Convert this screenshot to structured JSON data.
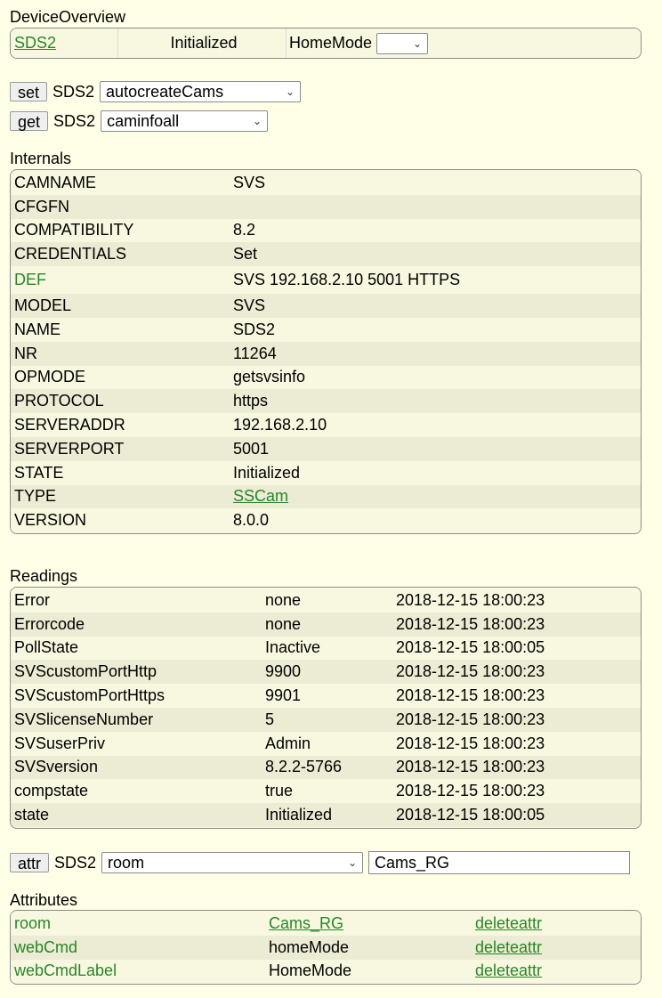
{
  "overview": {
    "title": "DeviceOverview",
    "device_link": "SDS2",
    "state": "Initialized",
    "homemode_label": "HomeMode",
    "homemode_value": ""
  },
  "set_row": {
    "button": "set",
    "device": "SDS2",
    "selected": "autocreateCams"
  },
  "get_row": {
    "button": "get",
    "device": "SDS2",
    "selected": "caminfoall"
  },
  "internals": {
    "title": "Internals",
    "rows": [
      {
        "key": "CAMNAME",
        "value": "SVS"
      },
      {
        "key": "CFGFN",
        "value": ""
      },
      {
        "key": "COMPATIBILITY",
        "value": "8.2"
      },
      {
        "key": "CREDENTIALS",
        "value": "Set"
      },
      {
        "key": "DEF",
        "value": "SVS 192.168.2.10 5001 HTTPS"
      },
      {
        "key": "MODEL",
        "value": "SVS"
      },
      {
        "key": "NAME",
        "value": "SDS2"
      },
      {
        "key": "NR",
        "value": "11264"
      },
      {
        "key": "OPMODE",
        "value": "getsvsinfo"
      },
      {
        "key": "PROTOCOL",
        "value": "https"
      },
      {
        "key": "SERVERADDR",
        "value": "192.168.2.10"
      },
      {
        "key": "SERVERPORT",
        "value": "5001"
      },
      {
        "key": "STATE",
        "value": "Initialized"
      },
      {
        "key": "TYPE",
        "value": "SSCam"
      },
      {
        "key": "VERSION",
        "value": "8.0.0"
      }
    ]
  },
  "readings": {
    "title": "Readings",
    "rows": [
      {
        "name": "Error",
        "value": "none",
        "time": "2018-12-15 18:00:23"
      },
      {
        "name": "Errorcode",
        "value": "none",
        "time": "2018-12-15 18:00:23"
      },
      {
        "name": "PollState",
        "value": "Inactive",
        "time": "2018-12-15 18:00:05"
      },
      {
        "name": "SVScustomPortHttp",
        "value": "9900",
        "time": "2018-12-15 18:00:23"
      },
      {
        "name": "SVScustomPortHttps",
        "value": "9901",
        "time": "2018-12-15 18:00:23"
      },
      {
        "name": "SVSlicenseNumber",
        "value": "5",
        "time": "2018-12-15 18:00:23"
      },
      {
        "name": "SVSuserPriv",
        "value": "Admin",
        "time": "2018-12-15 18:00:23"
      },
      {
        "name": "SVSversion",
        "value": "8.2.2-5766",
        "time": "2018-12-15 18:00:23"
      },
      {
        "name": "compstate",
        "value": "true",
        "time": "2018-12-15 18:00:23"
      },
      {
        "name": "state",
        "value": "Initialized",
        "time": "2018-12-15 18:00:05"
      }
    ]
  },
  "attr_row": {
    "button": "attr",
    "device": "SDS2",
    "selected": "room",
    "value": "Cams_RG"
  },
  "attributes": {
    "title": "Attributes",
    "rows": [
      {
        "name": "room",
        "value": "Cams_RG",
        "action": "deleteattr"
      },
      {
        "name": "webCmd",
        "value": "homeMode",
        "action": "deleteattr"
      },
      {
        "name": "webCmdLabel",
        "value": "HomeMode",
        "action": "deleteattr"
      }
    ]
  }
}
